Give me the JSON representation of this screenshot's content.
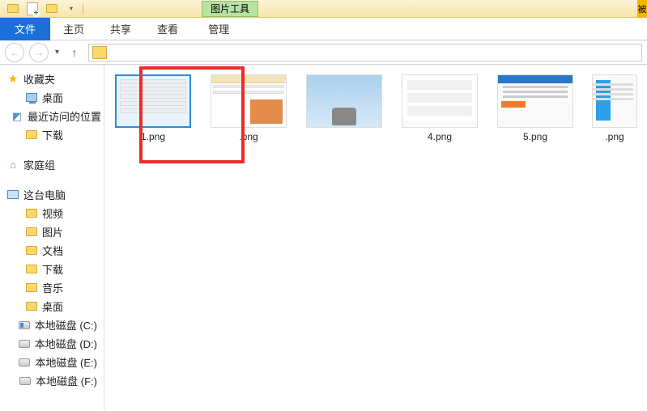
{
  "titlebar": {
    "context_tab": "图片工具",
    "right_edge": "被"
  },
  "ribbon": {
    "file": "文件",
    "tabs": [
      "主页",
      "共享",
      "查看"
    ],
    "context": "管理"
  },
  "sidebar": {
    "favorites": {
      "label": "收藏夹",
      "items": [
        "桌面",
        "最近访问的位置",
        "下载"
      ]
    },
    "homegroup": {
      "label": "家庭组"
    },
    "thispc": {
      "label": "这台电脑",
      "items": [
        "视频",
        "图片",
        "文档",
        "下载",
        "音乐",
        "桌面",
        "本地磁盘 (C:)",
        "本地磁盘 (D:)",
        "本地磁盘 (E:)",
        "本地磁盘 (F:)"
      ]
    }
  },
  "files": [
    {
      "name": "1.png",
      "selected": true
    },
    {
      "name": ".png",
      "selected": false
    },
    {
      "name": "",
      "selected": false
    },
    {
      "name": "4.png",
      "selected": false
    },
    {
      "name": "5.png",
      "selected": false
    },
    {
      "name": ".png",
      "selected": false
    }
  ]
}
